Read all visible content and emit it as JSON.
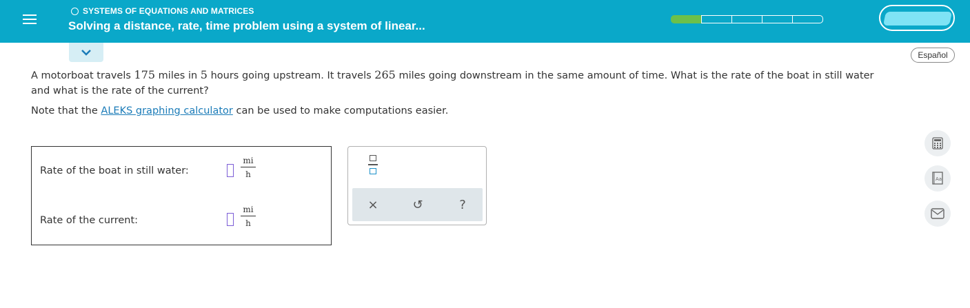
{
  "header": {
    "topic": "SYSTEMS OF EQUATIONS AND MATRICES",
    "lesson_title": "Solving a distance, rate, time problem using a system of linear...",
    "progress": {
      "completed_segments": 1,
      "total_segments": 5
    },
    "menu_icon": "hamburger-icon"
  },
  "language_button": "Español",
  "problem": {
    "part1": "A motorboat travels ",
    "n1": "175",
    "part2": " miles in ",
    "n2": "5",
    "part3": " hours going upstream. It travels ",
    "n3": "265",
    "part4": " miles going downstream in the same amount of time. What is the rate of the boat in still water and what is the rate of the current?"
  },
  "note": {
    "before": "Note that the ",
    "link": "ALEKS graphing calculator",
    "after": " can be used to make computations easier."
  },
  "answers": {
    "row1_label": "Rate of the boat in still water:",
    "row2_label": "Rate of the current:",
    "unit_num": "mi",
    "unit_den": "h"
  },
  "keypad": {
    "clear_symbol": "×",
    "undo_symbol": "↺",
    "help_symbol": "?"
  },
  "tools": [
    "calculator-icon",
    "dictionary-icon",
    "mail-icon"
  ],
  "colors": {
    "header": "#0aa8c9",
    "progress_done": "#6cc04a",
    "link": "#1a7bb8",
    "input_border": "#7b5cd6"
  }
}
